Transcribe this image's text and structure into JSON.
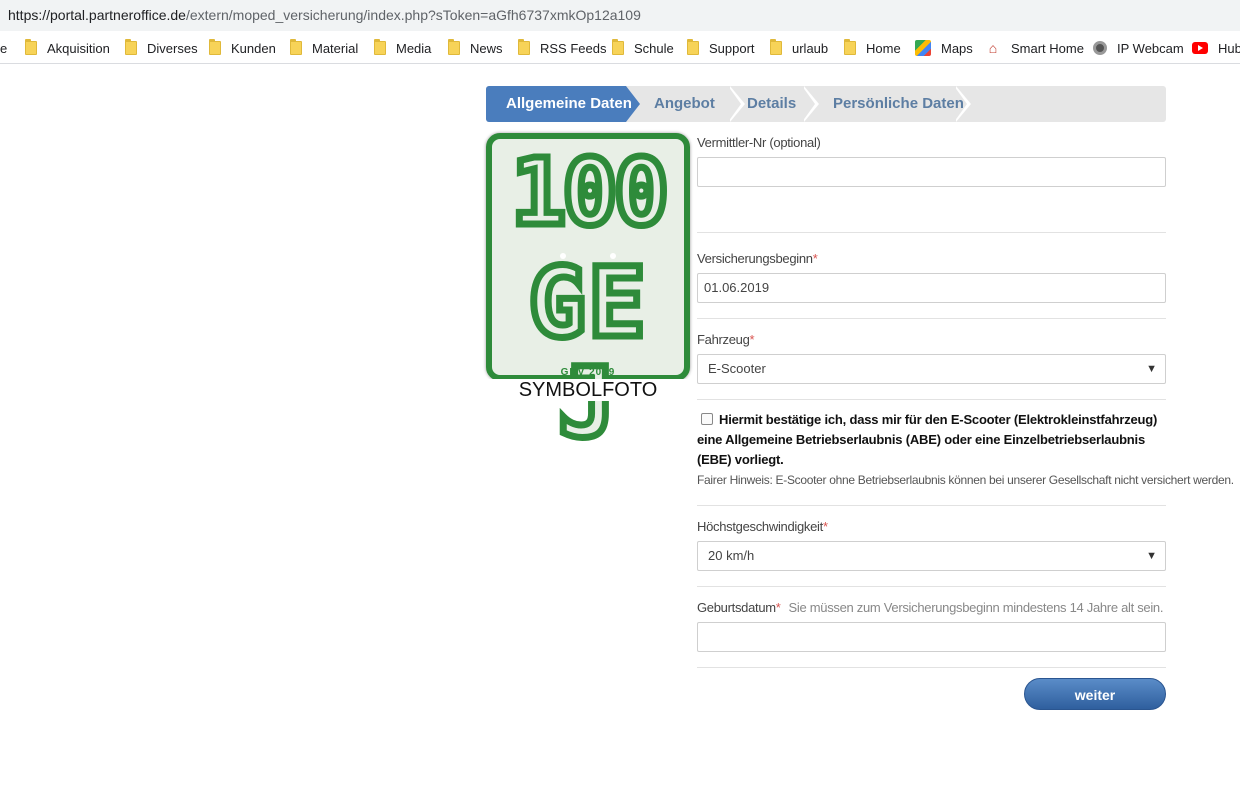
{
  "browser": {
    "url_host": "https://portal.partneroffice.de",
    "url_path": "/extern/moped_versicherung/index.php?sToken=aGfh6737xmkOp12a109",
    "bookmarks": [
      {
        "label": "e",
        "icon": "folder-icon"
      },
      {
        "label": "Akquisition",
        "icon": "folder-icon"
      },
      {
        "label": "Diverses",
        "icon": "folder-icon"
      },
      {
        "label": "Kunden",
        "icon": "folder-icon"
      },
      {
        "label": "Material",
        "icon": "folder-icon"
      },
      {
        "label": "Media",
        "icon": "folder-icon"
      },
      {
        "label": "News",
        "icon": "folder-icon"
      },
      {
        "label": "RSS Feeds",
        "icon": "folder-icon"
      },
      {
        "label": "Schule",
        "icon": "folder-icon"
      },
      {
        "label": "Support",
        "icon": "folder-icon"
      },
      {
        "label": "urlaub",
        "icon": "folder-icon"
      },
      {
        "label": "Home",
        "icon": "folder-icon"
      },
      {
        "label": "Maps",
        "icon": "maps-icon"
      },
      {
        "label": "Smart Home",
        "icon": "smart-home-icon"
      },
      {
        "label": "IP Webcam",
        "icon": "webcam-icon"
      },
      {
        "label": "Hubs",
        "icon": "youtube-icon"
      }
    ]
  },
  "wizard": {
    "steps": [
      "Allgemeine Daten",
      "Angebot",
      "Details",
      "Persönliche Daten"
    ],
    "active_step": "Allgemeine Daten",
    "active_color": "#4a7dbd"
  },
  "plate": {
    "line1": "100",
    "line2": "GE J",
    "footer": "GDV 2019",
    "caption": "SYMBOLFOTO",
    "color": "#2e8b3a"
  },
  "form": {
    "vermittler": {
      "label": "Vermittler-Nr (optional)",
      "value": ""
    },
    "versicherungsbeginn": {
      "label": "Versicherungsbeginn",
      "required_mark": "*",
      "value": "01.06.2019"
    },
    "fahrzeug": {
      "label": "Fahrzeug",
      "required_mark": "*",
      "value": "E-Scooter"
    },
    "confirm_text": "Hiermit bestätige ich, dass mir für den E-Scooter (Elektrokleinstfahrzeug) eine Allgemeine Betriebserlaubnis (ABE) oder eine Einzelbetriebserlaubnis (EBE) vorliegt.",
    "confirm_checked": false,
    "hinweis": "Fairer Hinweis: E-Scooter ohne Betriebserlaubnis können bei unserer Gesellschaft nicht versichert werden.",
    "geschwindigkeit": {
      "label": "Höchstgeschwindigkeit",
      "required_mark": "*",
      "value": "20 km/h"
    },
    "geburtsdatum": {
      "label": "Geburtsdatum",
      "required_mark": "*",
      "hint": "Sie müssen zum Versicherungsbeginn mindestens 14 Jahre alt sein.",
      "value": ""
    },
    "submit_label": "weiter"
  }
}
